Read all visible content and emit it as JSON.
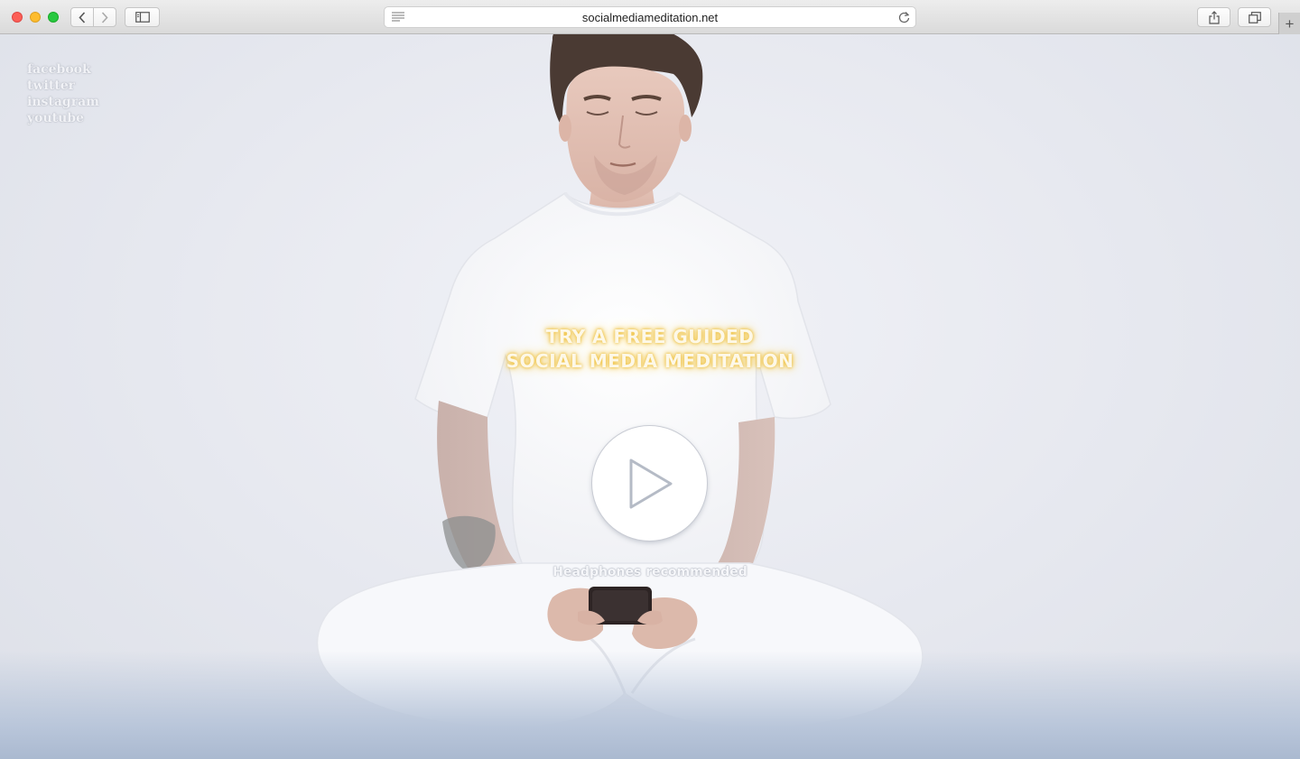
{
  "browser": {
    "url": "socialmediameditation.net",
    "icons": {
      "back": "chevron-left-icon",
      "forward": "chevron-right-icon",
      "sidebar": "sidebar-icon",
      "reader": "reader-lines-icon",
      "reload": "reload-icon",
      "share": "share-icon",
      "tabs": "tabs-overview-icon",
      "new_tab": "plus-icon"
    },
    "new_tab_glyph": "+"
  },
  "social": {
    "links": [
      {
        "label": "facebook"
      },
      {
        "label": "twitter"
      },
      {
        "label": "instagram"
      },
      {
        "label": "youtube"
      }
    ]
  },
  "hero": {
    "headline_line1": "TRY A FREE GUIDED",
    "headline_line2": "SOCIAL MEDIA MEDITATION",
    "headline_glow_color": "#f2c64a",
    "play_icon": "play-icon",
    "note": "Headphones recommended"
  }
}
